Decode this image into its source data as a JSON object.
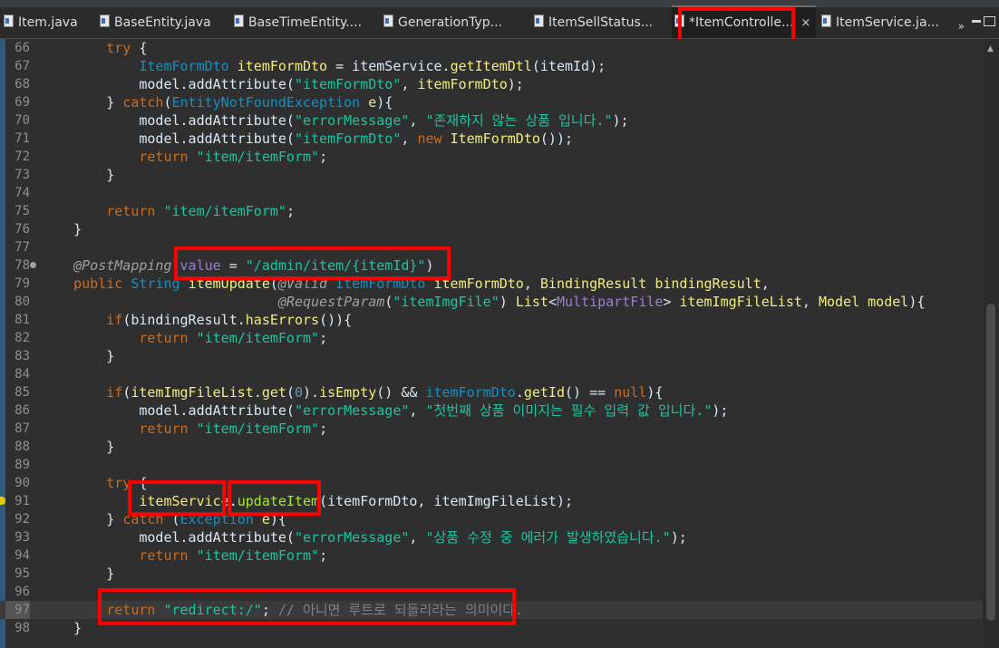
{
  "tabs": [
    {
      "label": "Item.java",
      "icon": "java-file-icon"
    },
    {
      "label": "BaseEntity.java",
      "icon": "java-file-icon"
    },
    {
      "label": "BaseTimeEntity....",
      "icon": "java-file-icon"
    },
    {
      "label": "GenerationTyp...",
      "icon": "class-file-icon"
    },
    {
      "label": "ItemSellStatus...",
      "icon": "java-file-icon"
    },
    {
      "label": "*ItemControlle...",
      "icon": "java-file-icon",
      "active": true,
      "close": "×"
    },
    {
      "label": "ItemService.ja...",
      "icon": "java-file-icon"
    }
  ],
  "tab_menu": "»",
  "editor": {
    "lines": [
      {
        "n": "66",
        "text": "        try {"
      },
      {
        "n": "67",
        "text": "            ItemFormDto itemFormDto = itemService.getItemDtl(itemId);"
      },
      {
        "n": "68",
        "text": "            model.addAttribute(\"itemFormDto\", itemFormDto);"
      },
      {
        "n": "69",
        "text": "        } catch(EntityNotFoundException e){"
      },
      {
        "n": "70",
        "text": "            model.addAttribute(\"errorMessage\", \"존재하지 않는 상품 입니다.\");"
      },
      {
        "n": "71",
        "text": "            model.addAttribute(\"itemFormDto\", new ItemFormDto());"
      },
      {
        "n": "72",
        "text": "            return \"item/itemForm\";"
      },
      {
        "n": "73",
        "text": "        }"
      },
      {
        "n": "74",
        "text": ""
      },
      {
        "n": "75",
        "text": "        return \"item/itemForm\";"
      },
      {
        "n": "76",
        "text": "    }"
      },
      {
        "n": "77",
        "text": ""
      },
      {
        "n": "78",
        "text": "    @PostMapping(value = \"/admin/item/{itemId}\")"
      },
      {
        "n": "79",
        "text": "    public String itemUpdate(@Valid ItemFormDto itemFormDto, BindingResult bindingResult,"
      },
      {
        "n": "80",
        "text": "                             @RequestParam(\"itemImgFile\") List<MultipartFile> itemImgFileList, Model model){"
      },
      {
        "n": "81",
        "text": "        if(bindingResult.hasErrors()){"
      },
      {
        "n": "82",
        "text": "            return \"item/itemForm\";"
      },
      {
        "n": "83",
        "text": "        }"
      },
      {
        "n": "84",
        "text": ""
      },
      {
        "n": "85",
        "text": "        if(itemImgFileList.get(0).isEmpty() && itemFormDto.getId() == null){"
      },
      {
        "n": "86",
        "text": "            model.addAttribute(\"errorMessage\", \"첫번째 상품 이미지는 필수 입력 값 입니다.\");"
      },
      {
        "n": "87",
        "text": "            return \"item/itemForm\";"
      },
      {
        "n": "88",
        "text": "        }"
      },
      {
        "n": "89",
        "text": ""
      },
      {
        "n": "90",
        "text": "        try {"
      },
      {
        "n": "91",
        "text": "            itemService.updateItem(itemFormDto, itemImgFileList);"
      },
      {
        "n": "92",
        "text": "        } catch (Exception e){"
      },
      {
        "n": "93",
        "text": "            model.addAttribute(\"errorMessage\", \"상품 수정 중 에러가 발생하였습니다.\");"
      },
      {
        "n": "94",
        "text": "            return \"item/itemForm\";"
      },
      {
        "n": "95",
        "text": "        }"
      },
      {
        "n": "96",
        "text": ""
      },
      {
        "n": "97",
        "text": "        return \"redirect:/\"; // 아니면 루트로 되돌리라는 의미이다.",
        "current": true
      },
      {
        "n": "98",
        "text": "    }"
      }
    ]
  },
  "colors": {
    "keyword": "#cc6c1d",
    "string": "#17c6a3",
    "type": "#1290c3",
    "annotation_box": "#ff0000",
    "background": "#2f2f2f"
  }
}
